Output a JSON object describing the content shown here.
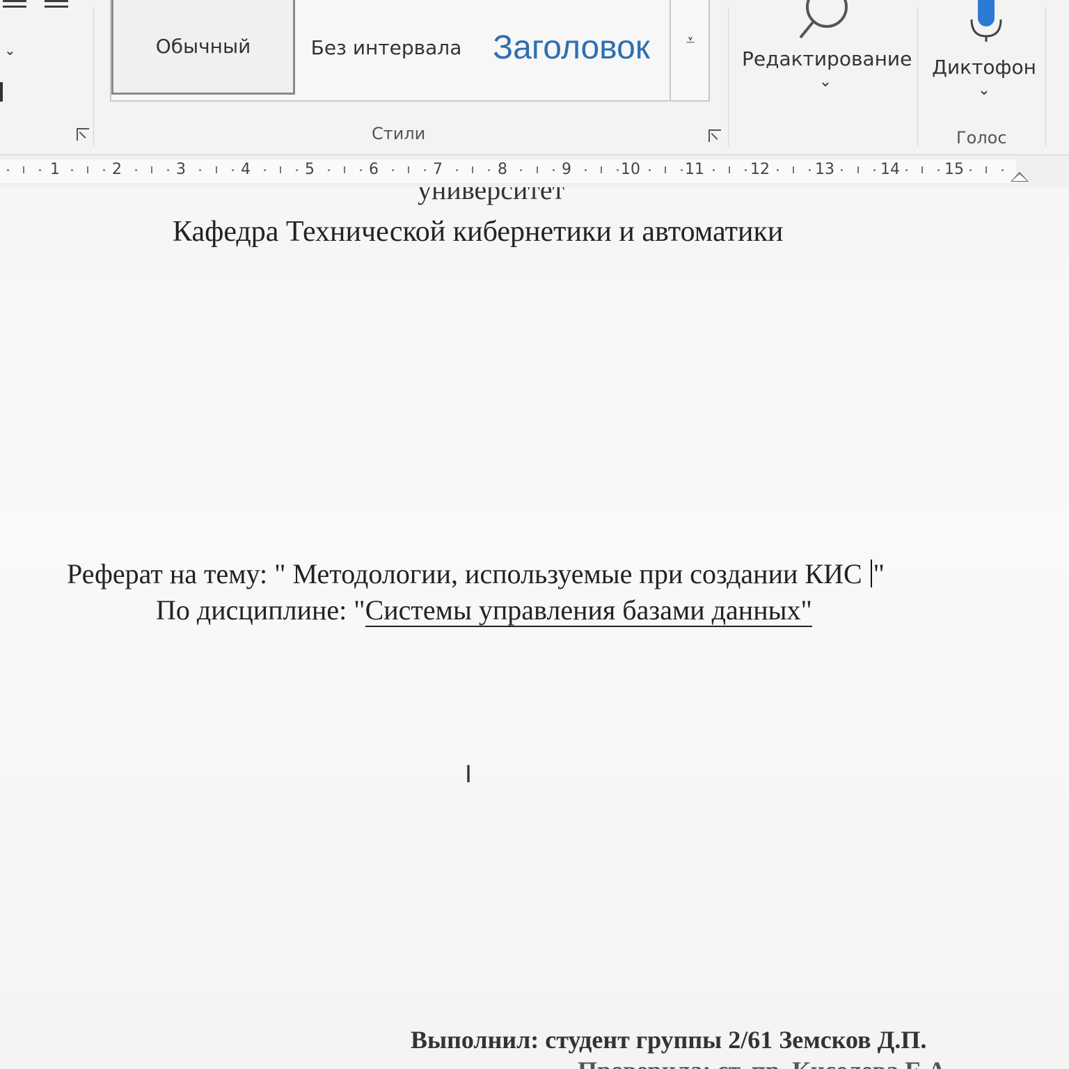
{
  "ribbon": {
    "styles": {
      "items": [
        "Обычный",
        "Без интервала",
        "Заголовок"
      ],
      "selected": "Обычный",
      "group_label": "Стили"
    },
    "editing_label": "Редактирование",
    "dictate_label": "Диктофон",
    "voice_group_label": "Голос"
  },
  "ruler": {
    "numbers": [
      "1",
      "2",
      "3",
      "4",
      "5",
      "6",
      "7",
      "8",
      "9",
      "10",
      "11",
      "12",
      "13",
      "14",
      "15"
    ]
  },
  "document": {
    "university_partial": "университет",
    "department": "Кафедра Технической кибернетики и автоматики",
    "topic_prefix": "Реферат на тему: \" Методологии, используемые при создании КИС ",
    "topic_suffix": "\"",
    "discipline_prefix": "По дисциплине: \"",
    "discipline_value": "Системы управления базами данных\"",
    "author_line": "Выполнил: студент группы 2/61 Земсков Д.П.",
    "checker_partial": "Проверила: ст. пр. Киселева Е.А."
  },
  "colors": {
    "heading_style": "#2e6fb0",
    "mic_accent": "#2b7bd6",
    "ribbon_bg": "#f3f3f3"
  }
}
